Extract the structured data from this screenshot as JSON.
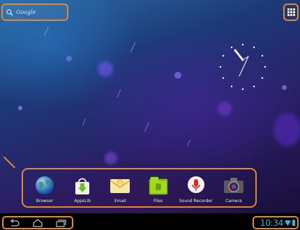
{
  "search": {
    "label": "Google"
  },
  "dock": {
    "items": [
      {
        "label": "Browser",
        "icon": "globe-icon"
      },
      {
        "label": "AppsLib",
        "icon": "shopping-bag-icon"
      },
      {
        "label": "Email",
        "icon": "email-icon"
      },
      {
        "label": "Files",
        "icon": "folder-icon"
      },
      {
        "label": "Sound Recorder",
        "icon": "microphone-icon"
      },
      {
        "label": "Camera",
        "icon": "camera-icon"
      }
    ]
  },
  "status_bar": {
    "time": "10:34"
  },
  "colors": {
    "highlight": "#e5892f",
    "time_text": "#33b5e5"
  }
}
